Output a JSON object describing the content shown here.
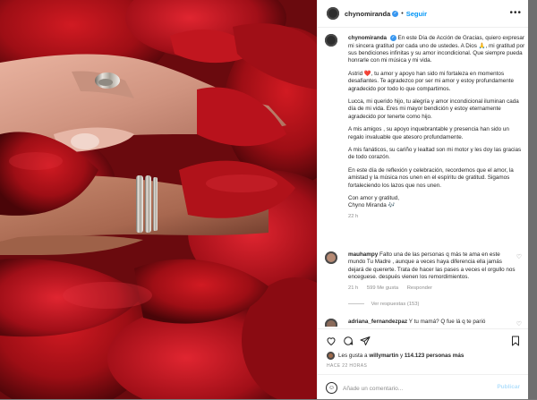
{
  "post": {
    "username": "chynomiranda",
    "follow_label": "Seguir",
    "more_label": "•••"
  },
  "caption": {
    "username": "chynomiranda",
    "p1": "En este Día de Acción de Gracias, quiero expresar mi sincera gratitud por cada uno de ustedes. A Dios 🙏, mi gratitud por sus bendiciones infinitas y su amor incondicional. Que siempre pueda honrarle con mi música y mi vida.",
    "p2": "Astrid ❤️, tu amor y apoyo han sido mi fortaleza en momentos desafiantes. Te agradezco por ser mi amor y estoy profundamente agradecido por todo lo que compartimos.",
    "p3": "Lucca, mi querido hijo, tu alegría y amor incondicional iluminan cada día de mi vida. Eres mi mayor bendición y estoy eternamente agradecido por tenerte como hijo.",
    "p4": "A mis amigos , su apoyo inquebrantable y presencia han sido un regalo invaluable que atesoro profundamente.",
    "p5": "A mis fanáticos, su cariño y lealtad son mi motor y les doy las gracias de todo corazón.",
    "p6": "En este día de reflexión y celebración, recordemos que el amor, la amistad y la música nos unen en el espíritu de gratitud. Sigamos fortaleciendo los lazos que nos unen.",
    "closing1": "Con amor y gratitud,",
    "closing2": "Chyno Miranda 🎶",
    "time": "22 h"
  },
  "comments": [
    {
      "username": "mauhampy",
      "text": "Falto una de las personas q más te ama en este mundo Tu Madre , aunque a veces haya diferencia ella jamás dejará de quererte. Trata de hacer las pases a veces el orgullo nos enceguese. después vienen los remordimientos.",
      "time": "21 h",
      "likes": "599 Me gusta",
      "reply_label": "Responder",
      "view_replies": "Ver respuestas (153)"
    },
    {
      "username": "adriana_fernandezpaz",
      "text": "Y tu mamá? Q fue lá q te parió"
    }
  ],
  "likes_line": {
    "prefix": "Les gusta a",
    "user": "willymartin",
    "mid": "y",
    "count": "114.123 personas más"
  },
  "date": "HACE 22 HORAS",
  "add_comment": {
    "placeholder": "Añade un comentario...",
    "publish_label": "Publicar"
  },
  "icons": {
    "like": "heart-icon",
    "comment": "comment-icon",
    "share": "share-icon",
    "save": "bookmark-icon",
    "emoji": "emoji-icon"
  },
  "colors": {
    "link": "#0095f6",
    "verified": "#3897f0",
    "text": "#262626",
    "muted": "#8e8e8e"
  }
}
